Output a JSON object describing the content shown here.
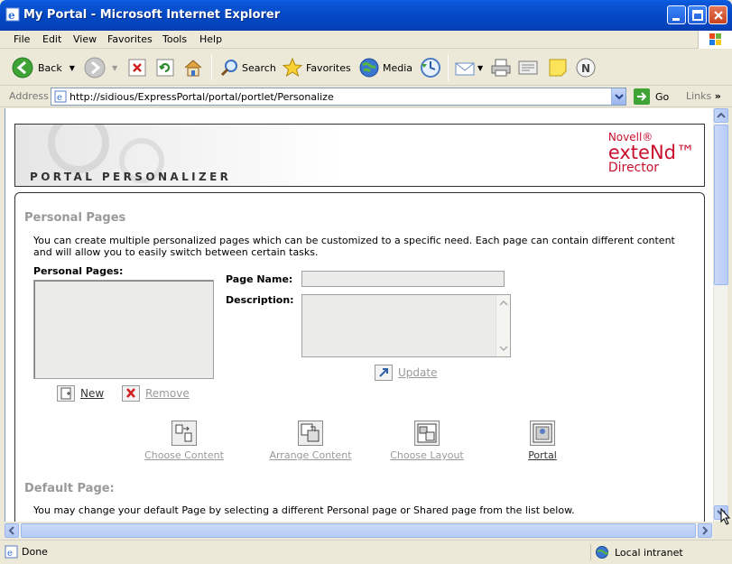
{
  "window": {
    "title": "My Portal - Microsoft Internet Explorer"
  },
  "menu": [
    "File",
    "Edit",
    "View",
    "Favorites",
    "Tools",
    "Help"
  ],
  "toolbar": {
    "back": "Back",
    "search": "Search",
    "favorites": "Favorites",
    "media": "Media"
  },
  "address": {
    "label": "Address",
    "url": "http://sidious/ExpressPortal/portal/portlet/Personalize",
    "go": "Go",
    "links": "Links"
  },
  "banner": {
    "title": "PORTAL PERSONALIZER",
    "brand_novell": "Novell®",
    "brand_extend": "exteNd™",
    "brand_director": "Director"
  },
  "personal_pages": {
    "heading": "Personal Pages",
    "description": "You can create multiple personalized pages which can be customized to a specific need. Each page can contain different content and will allow you to easily switch between certain tasks.",
    "list_label": "Personal Pages:",
    "page_name_label": "Page Name:",
    "description_label": "Description:",
    "page_name_value": "",
    "description_value": "",
    "update": "Update",
    "new": "New",
    "remove": "Remove"
  },
  "nav": {
    "choose_content": "Choose Content",
    "arrange_content": "Arrange Content",
    "choose_layout": "Choose Layout",
    "portal": "Portal"
  },
  "default_page": {
    "heading": "Default Page:",
    "description": "You may change your default Page by selecting a different Personal page or Shared page from the list below."
  },
  "status": {
    "text": "Done",
    "zone": "Local intranet"
  },
  "colors": {
    "brand_red": "#c8102e",
    "title_blue": "#0348c4",
    "disabled_gray": "#999999"
  }
}
